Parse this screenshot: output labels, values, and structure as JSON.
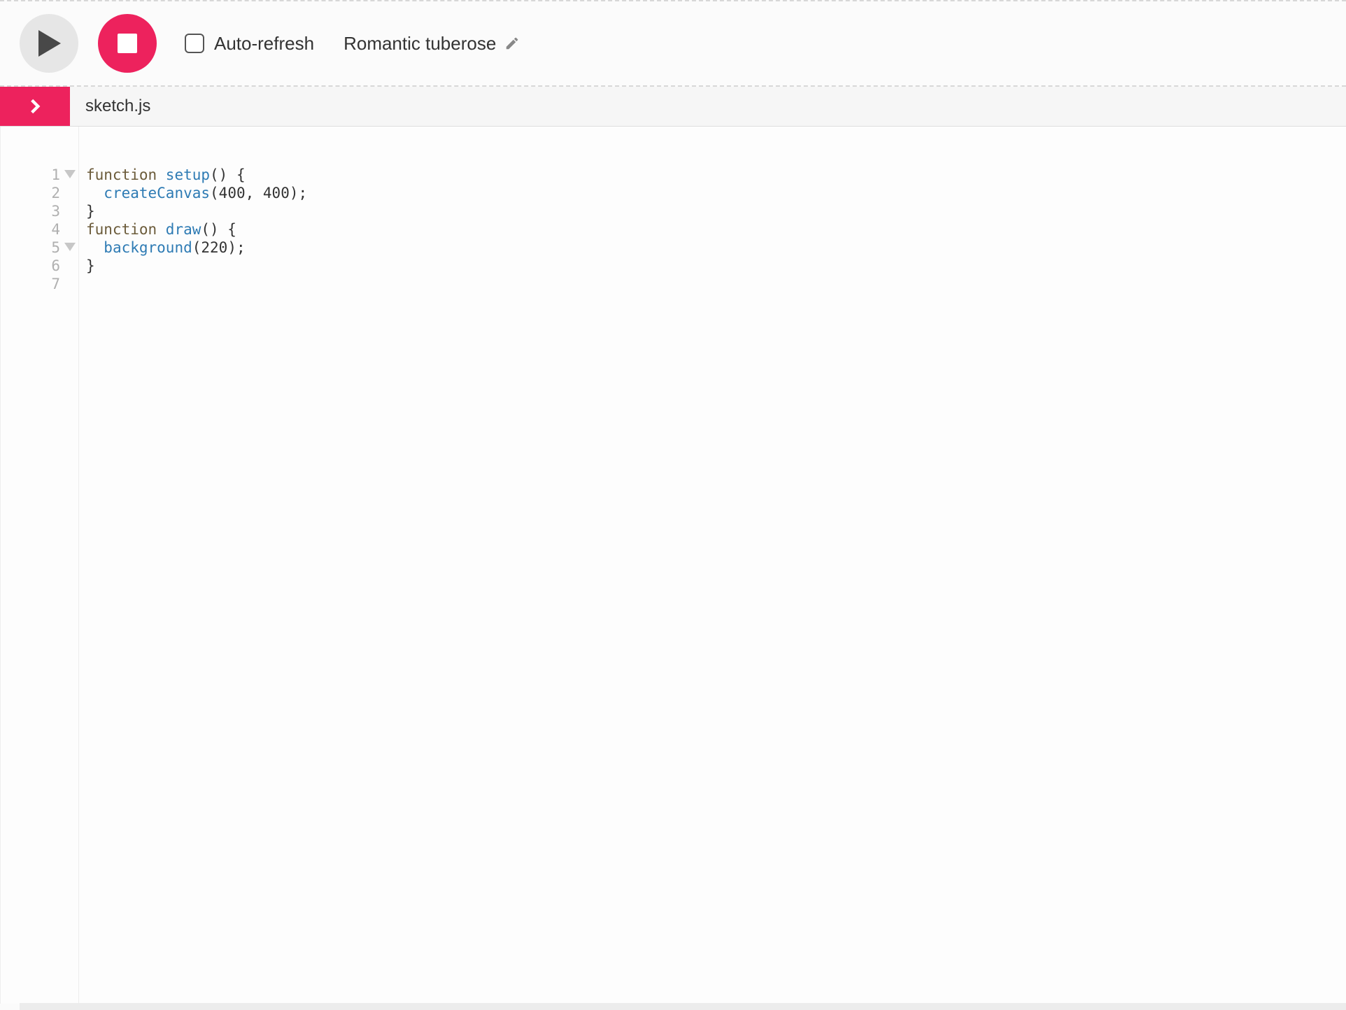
{
  "toolbar": {
    "auto_refresh_label": "Auto-refresh",
    "auto_refresh_checked": false,
    "sketch_name": "Romantic tuberose"
  },
  "file": {
    "name": "sketch.js"
  },
  "editor": {
    "lines": [
      {
        "n": 1,
        "foldable": true,
        "tokens": [
          {
            "t": "function ",
            "c": "tok-keyword"
          },
          {
            "t": "setup",
            "c": "tok-def"
          },
          {
            "t": "() {",
            "c": "tok-paren"
          }
        ]
      },
      {
        "n": 2,
        "foldable": false,
        "tokens": [
          {
            "t": "  ",
            "c": ""
          },
          {
            "t": "createCanvas",
            "c": "tok-func"
          },
          {
            "t": "(",
            "c": "tok-paren"
          },
          {
            "t": "400",
            "c": "tok-number"
          },
          {
            "t": ", ",
            "c": "tok-punct"
          },
          {
            "t": "400",
            "c": "tok-number"
          },
          {
            "t": ");",
            "c": "tok-paren"
          }
        ]
      },
      {
        "n": 3,
        "foldable": false,
        "tokens": [
          {
            "t": "}",
            "c": "tok-brace"
          }
        ]
      },
      {
        "n": 4,
        "foldable": false,
        "tokens": [
          {
            "t": "",
            "c": ""
          }
        ]
      },
      {
        "n": 5,
        "foldable": true,
        "tokens": [
          {
            "t": "function ",
            "c": "tok-keyword"
          },
          {
            "t": "draw",
            "c": "tok-def"
          },
          {
            "t": "() {",
            "c": "tok-paren"
          }
        ]
      },
      {
        "n": 6,
        "foldable": false,
        "tokens": [
          {
            "t": "  ",
            "c": ""
          },
          {
            "t": "background",
            "c": "tok-func"
          },
          {
            "t": "(",
            "c": "tok-paren"
          },
          {
            "t": "220",
            "c": "tok-number"
          },
          {
            "t": ");",
            "c": "tok-paren"
          }
        ]
      },
      {
        "n": 7,
        "foldable": false,
        "tokens": [
          {
            "t": "}",
            "c": "tok-brace"
          }
        ]
      }
    ]
  },
  "colors": {
    "accent": "#ed225d"
  }
}
